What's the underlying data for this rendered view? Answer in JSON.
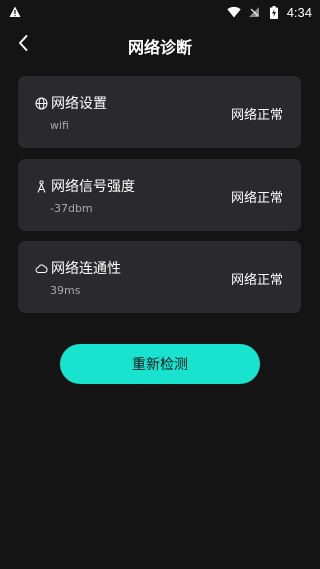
{
  "status_bar": {
    "time": "4:34",
    "icons": [
      "alert-icon",
      "wifi-icon",
      "no-sim-icon",
      "battery-icon"
    ]
  },
  "header": {
    "title": "网络诊断"
  },
  "cards": [
    {
      "icon": "globe-icon",
      "title": "网络设置",
      "subtitle": "wifi",
      "status": "网络正常"
    },
    {
      "icon": "signal-tower-icon",
      "title": "网络信号强度",
      "subtitle": "-37dbm",
      "status": "网络正常"
    },
    {
      "icon": "cloud-icon",
      "title": "网络连通性",
      "subtitle": "39ms",
      "status": "网络正常"
    }
  ],
  "actions": {
    "retest_label": "重新检测"
  },
  "colors": {
    "background": "#141414",
    "card": "#2a2a2c",
    "accent": "#17e3cf"
  }
}
